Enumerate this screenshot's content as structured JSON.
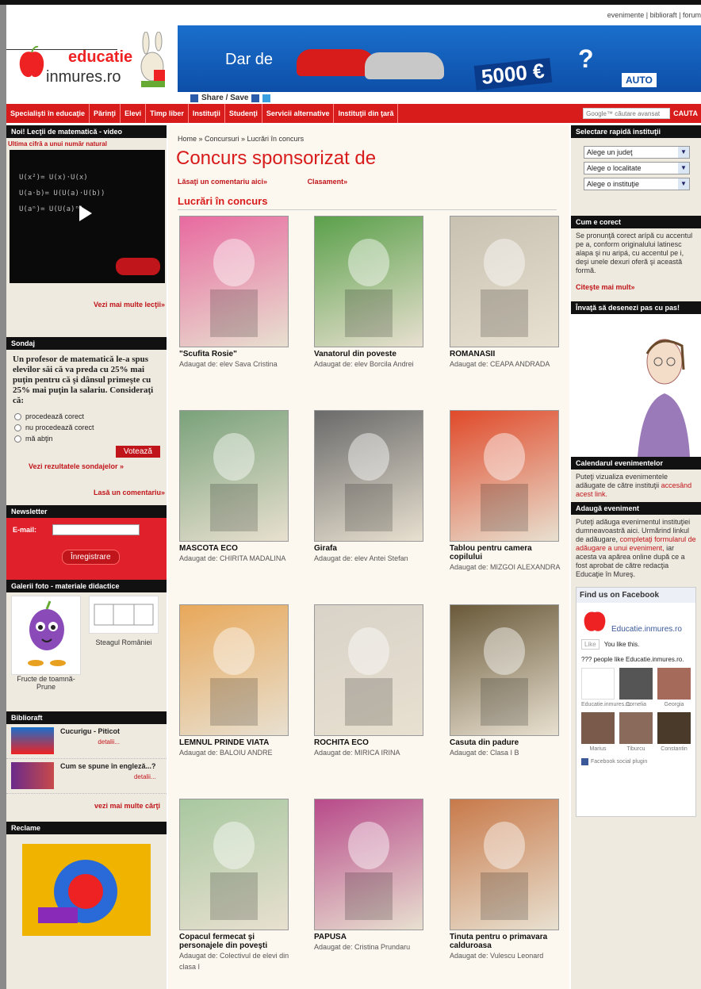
{
  "header": {
    "toplinks": "evenimente | biblioraft | forum",
    "logo_top": "educatie",
    "logo_bottom": "inmures.ro",
    "banner_title": "Dar de",
    "banner_price": "5000 €",
    "banner_q": "?",
    "banner_brand": "AUTO",
    "share_label": "Share / Save"
  },
  "nav": {
    "items": [
      "Specialişti în educaţie",
      "Părinţi",
      "Elevi",
      "Timp liber",
      "Instituţii",
      "Studenţi",
      "Servicii alternative",
      "Instituţii din ţară"
    ],
    "search_placeholder": "Google™ căutare avansat",
    "search_button": "CAUTA"
  },
  "left": {
    "lessons_title": "Noi! Lecţii de matematică - video",
    "lessons_sub": "Ultima cifră a unui număr natural",
    "lessons_more": "Vezi mai multe lecţii»",
    "poll_title": "Sondaj",
    "poll_question": "Un profesor de matematică le-a spus elevilor săi că va preda cu 25% mai puţin pentru că şi dânsul primeşte cu 25% mai puţin la salariu. Consideraţi că:",
    "poll_options": [
      "procedează corect",
      "nu procedează corect",
      "mă abţin"
    ],
    "poll_button": "Votează",
    "poll_results": "Vezi rezultatele sondajelor »",
    "poll_comment": "Lasă un comentariu»",
    "newsletter_title": "Newsletter",
    "newsletter_email_label": "E-mail:",
    "newsletter_button": "Înregistrare",
    "gallery_title": "Galerii foto - materiale didactice",
    "gallery_items": [
      "Fructe de toamnă-Prune",
      "Steagul României"
    ],
    "biblio_title": "Biblioraft",
    "books": [
      {
        "title": "Cucurigu - Piticot",
        "link": "detalii..."
      },
      {
        "title": "Cum se spune în engleză...?",
        "link": "detalii..."
      }
    ],
    "books_more": "vezi mai multe cărţi",
    "ads_title": "Reclame"
  },
  "center": {
    "breadcrumb": "Home » Concursuri » Lucrări în concurs",
    "title": "Concurs sponsorizat de",
    "link_comment": "Lăsaţi un comentariu aici»",
    "link_ranking": "Clasament»",
    "section": "Lucrări în concurs",
    "cards": [
      {
        "title": "\"Scufita Rosie\"",
        "by": "Adaugat de: elev Sava Cristina",
        "color": "#e86aa0"
      },
      {
        "title": "Vanatorul din poveste",
        "by": "Adaugat de: elev Borcila Andrei",
        "color": "#5aa04a"
      },
      {
        "title": "ROMANASII",
        "by": "Adaugat de: CEAPA ANDRADA",
        "color": "#c8c0b0"
      },
      {
        "title": "MASCOTA ECO",
        "by": "Adaugat de: CHIRITA MADALINA",
        "color": "#7aa27a"
      },
      {
        "title": "Girafa",
        "by": "Adaugat de: elev Antei Stefan",
        "color": "#6a6a6a"
      },
      {
        "title": "Tablou pentru camera copilului",
        "by": "Adaugat de: MIZGOI ALEXANDRA",
        "color": "#e04a2a"
      },
      {
        "title": "LEMNUL PRINDE VIATA",
        "by": "Adaugat de: BALOIU ANDRE",
        "color": "#e8a85a"
      },
      {
        "title": "ROCHITA ECO",
        "by": "Adaugat de: MIRICA IRINA",
        "color": "#d8d2c8"
      },
      {
        "title": "Casuta din padure",
        "by": "Adaugat de: Clasa I B",
        "color": "#6a5a3a"
      },
      {
        "title": "Copacul fermecat şi personajele din poveşti",
        "by": "Adaugat de: Colectivul de elevi din clasa I",
        "color": "#a8c8a0"
      },
      {
        "title": "PAPUSA",
        "by": "Adaugat de: Cristina Prundaru",
        "color": "#b84a8a"
      },
      {
        "title": "Tinuta pentru o primavara calduroasa",
        "by": "Adaugat de: Vulescu Leonard",
        "color": "#c87a4a"
      }
    ]
  },
  "right": {
    "quick_title": "Selectare rapidă instituţii",
    "selects": [
      "Alege un judeţ",
      "Alege o localitate",
      "Alege o instituţie"
    ],
    "correct_title": "Cum e corect",
    "correct_text": "Se pronunţă corect arípă cu accentul pe a, conform originalului latinesc alapa şi nu aripá, cu accentul pe i, deşi unele dexuri oferă şi această formă.",
    "correct_more": "Citeşte mai mult»",
    "draw_title": "Învaţă să desenezi pas cu pas!",
    "calendar_title": "Calendarul evenimentelor",
    "calendar_text": "Puteţi vizualiza evenimentele adăugate de către instituţii",
    "calendar_link": "accesând acest link.",
    "add_title": "Adaugă eveniment",
    "add_text1": "Puteţi adăuga evenimentul instituţiei dumneavoastră aici. Urmărind linkul de adăugare,",
    "add_link": "completaţi formularul de adăugare a unui eveniment,",
    "add_text2": "iar acesta va apărea online după ce a fost aprobat de către redacţia Educaţie în Mureş.",
    "fb_title": "Find us on Facebook",
    "fb_page": "Educatie.inmures.ro",
    "fb_like": "Like",
    "fb_you_like": "You like this.",
    "fb_count": "??? people like Educatie.inmures.ro.",
    "fb_people": [
      "Educatie.inmures.ro",
      "Cornelia",
      "Georgia",
      "Marius",
      "Tiburcu",
      "Constantin"
    ],
    "fb_plugin": "Facebook social plugin"
  }
}
